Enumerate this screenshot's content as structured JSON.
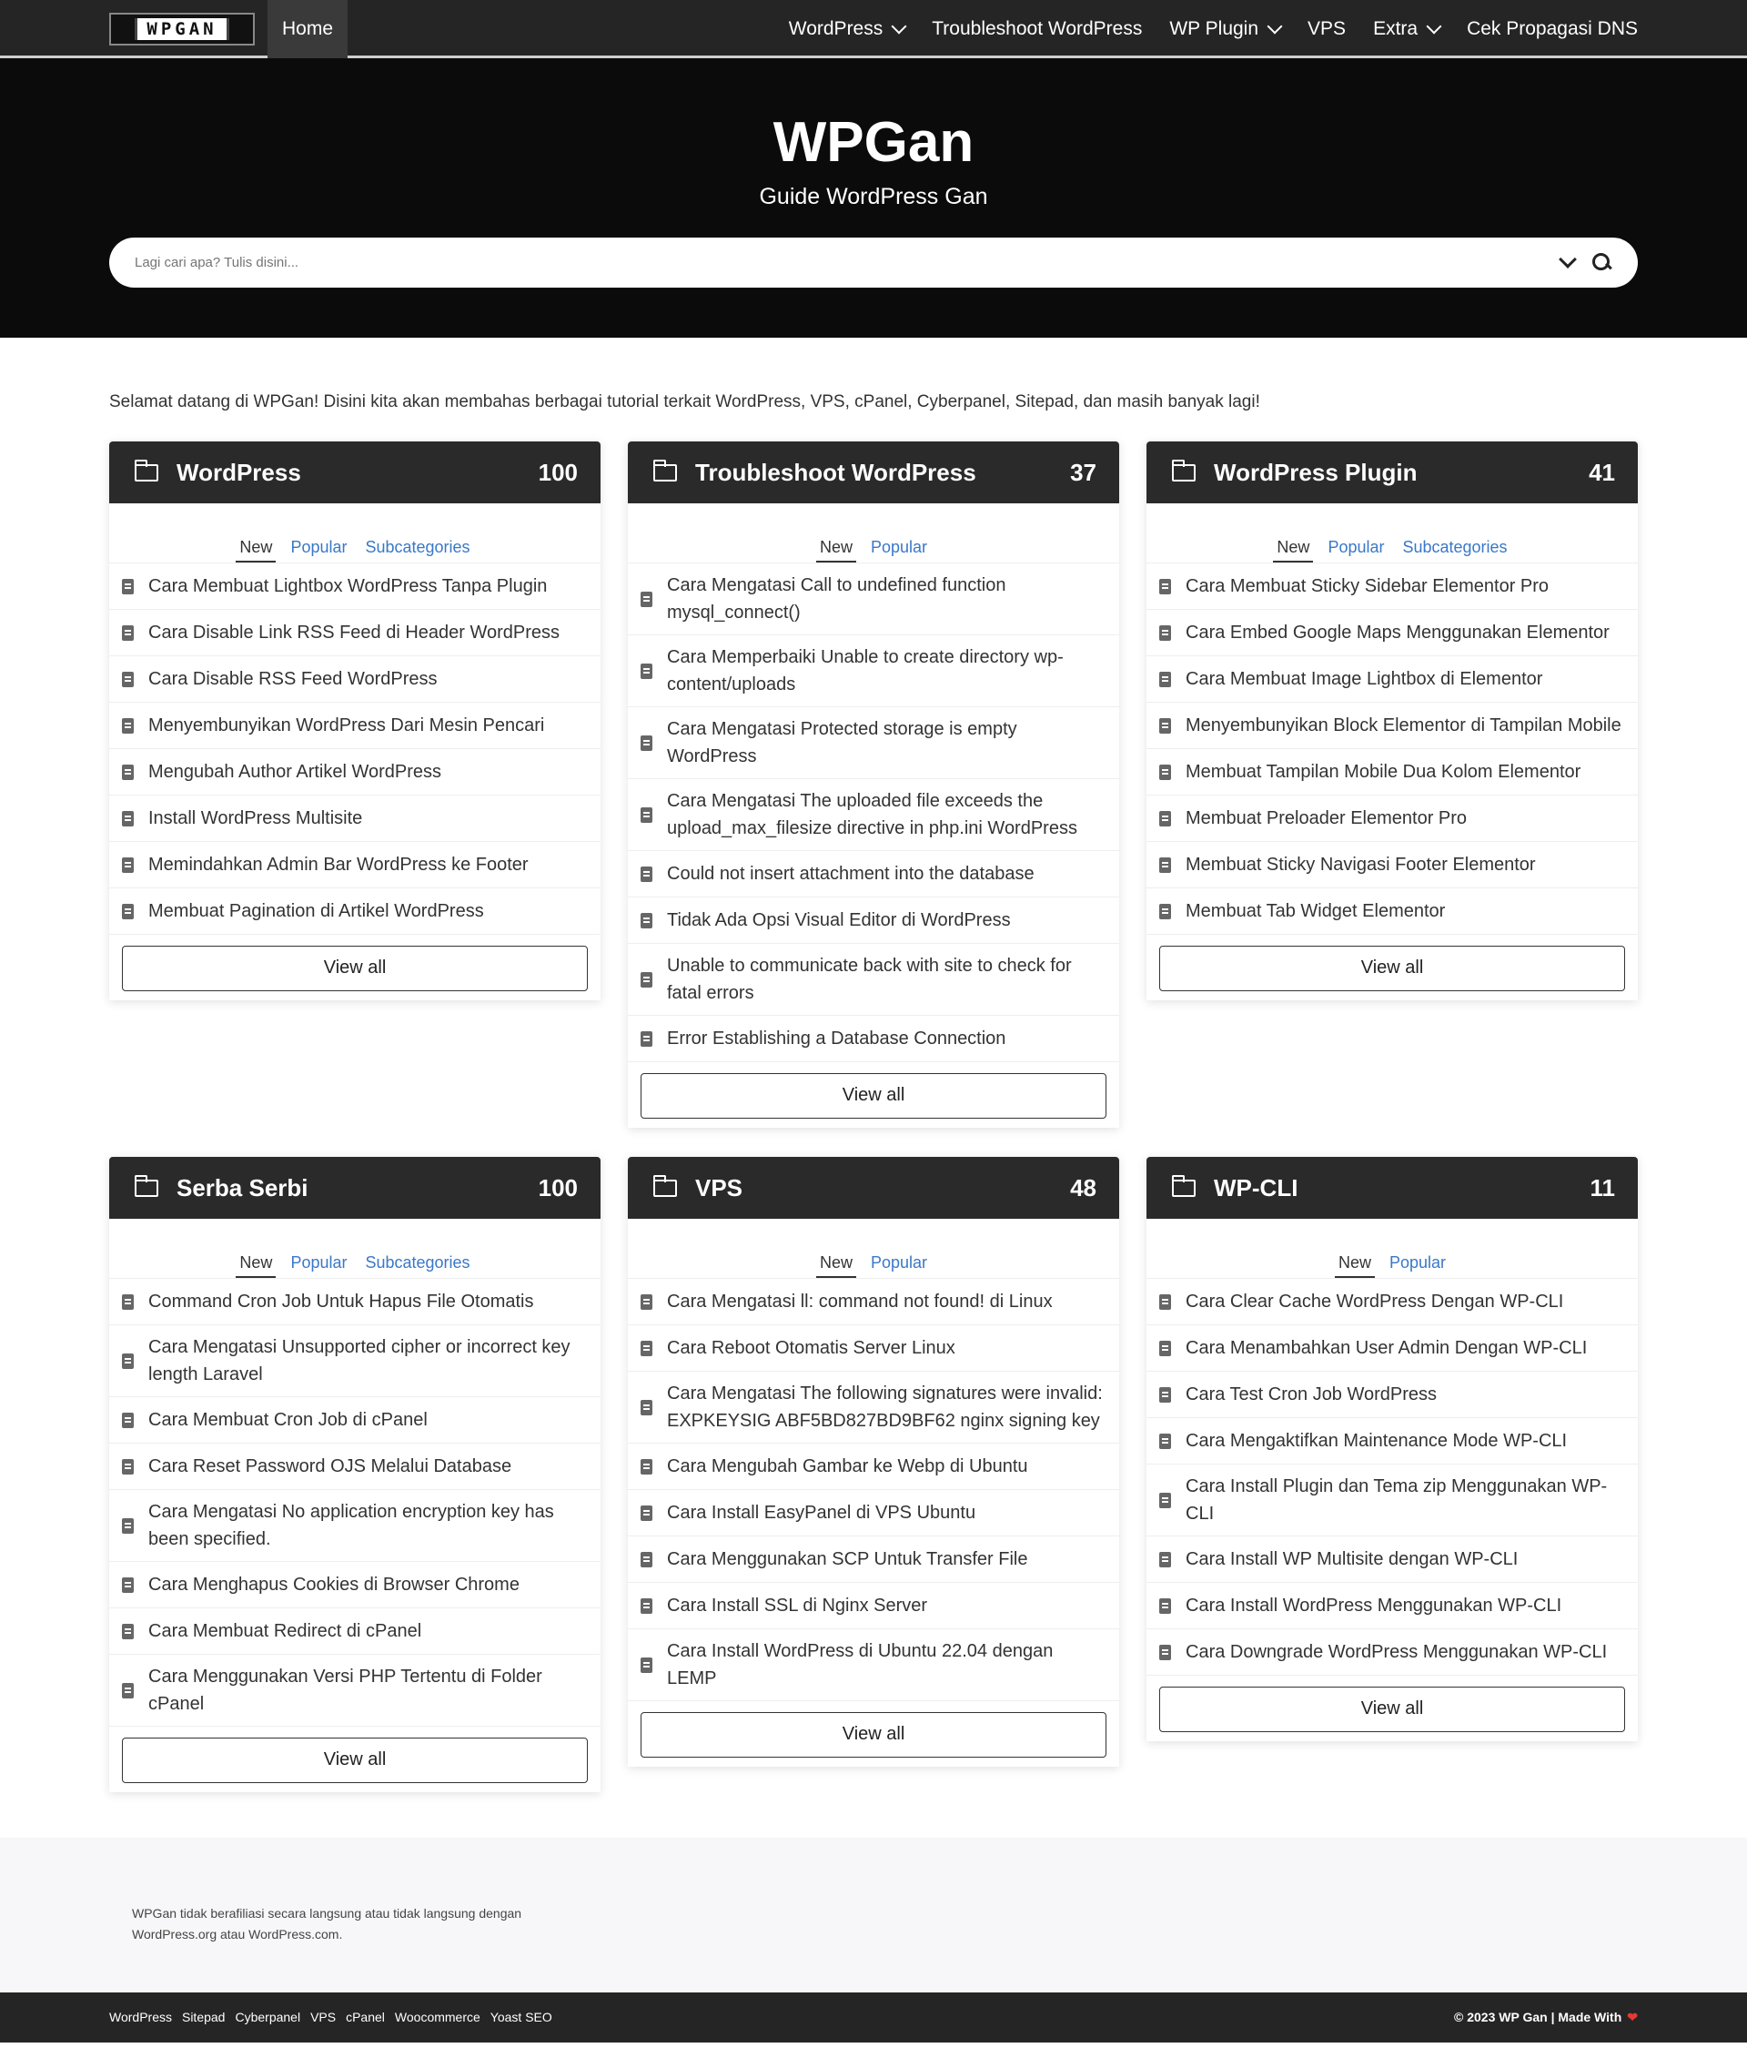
{
  "header": {
    "logo_text": "WPGAN",
    "home": "Home",
    "nav": [
      {
        "label": "WordPress",
        "dropdown": true
      },
      {
        "label": "Troubleshoot WordPress",
        "dropdown": false
      },
      {
        "label": "WP Plugin",
        "dropdown": true
      },
      {
        "label": "VPS",
        "dropdown": false
      },
      {
        "label": "Extra",
        "dropdown": true
      },
      {
        "label": "Cek Propagasi DNS",
        "dropdown": false
      }
    ]
  },
  "hero": {
    "title": "WPGan",
    "subtitle": "Guide WordPress Gan",
    "search_placeholder": "Lagi cari apa? Tulis disini..."
  },
  "intro": "Selamat datang di WPGan! Disini kita akan membahas berbagai tutorial terkait WordPress, VPS, cPanel, Cyberpanel, Sitepad, dan masih banyak lagi!",
  "cards": [
    {
      "title": "WordPress",
      "count": "100",
      "tabs": [
        "New",
        "Popular",
        "Subcategories"
      ],
      "items": [
        "Cara Membuat Lightbox WordPress Tanpa Plugin",
        "Cara Disable Link RSS Feed di Header WordPress",
        "Cara Disable RSS Feed WordPress",
        "Menyembunyikan WordPress Dari Mesin Pencari",
        "Mengubah Author Artikel WordPress",
        "Install WordPress Multisite",
        "Memindahkan Admin Bar WordPress ke Footer",
        "Membuat Pagination di Artikel WordPress"
      ],
      "view_all": "View all"
    },
    {
      "title": "Troubleshoot WordPress",
      "count": "37",
      "tabs": [
        "New",
        "Popular"
      ],
      "items": [
        "Cara Mengatasi Call to undefined function mysql_connect()",
        "Cara Memperbaiki Unable to create directory wp-content/uploads",
        "Cara Mengatasi Protected storage is empty WordPress",
        "Cara Mengatasi The uploaded file exceeds the upload_max_filesize directive in php.ini WordPress",
        "Could not insert attachment into the database",
        "Tidak Ada Opsi Visual Editor di WordPress",
        "Unable to communicate back with site to check for fatal errors",
        "Error Establishing a Database Connection"
      ],
      "view_all": "View all"
    },
    {
      "title": "WordPress Plugin",
      "count": "41",
      "tabs": [
        "New",
        "Popular",
        "Subcategories"
      ],
      "items": [
        "Cara Membuat Sticky Sidebar Elementor Pro",
        "Cara Embed Google Maps Menggunakan Elementor",
        "Cara Membuat Image Lightbox di Elementor",
        "Menyembunyikan Block Elementor di Tampilan Mobile",
        "Membuat Tampilan Mobile Dua Kolom Elementor",
        "Membuat Preloader Elementor Pro",
        "Membuat Sticky Navigasi Footer Elementor",
        "Membuat Tab Widget Elementor"
      ],
      "view_all": "View all"
    },
    {
      "title": "Serba Serbi",
      "count": "100",
      "tabs": [
        "New",
        "Popular",
        "Subcategories"
      ],
      "items": [
        "Command Cron Job Untuk Hapus File Otomatis",
        "Cara Mengatasi Unsupported cipher or incorrect key length Laravel",
        "Cara Membuat Cron Job di cPanel",
        "Cara Reset Password OJS Melalui Database",
        "Cara Mengatasi No application encryption key has been specified.",
        "Cara Menghapus Cookies di Browser Chrome",
        "Cara Membuat Redirect di cPanel",
        "Cara Menggunakan Versi PHP Tertentu di Folder cPanel"
      ],
      "view_all": "View all"
    },
    {
      "title": "VPS",
      "count": "48",
      "tabs": [
        "New",
        "Popular"
      ],
      "items": [
        "Cara Mengatasi ll: command not found! di Linux",
        "Cara Reboot Otomatis Server Linux",
        "Cara Mengatasi The following signatures were invalid: EXPKEYSIG ABF5BD827BD9BF62 nginx signing key",
        "Cara Mengubah Gambar ke Webp di Ubuntu",
        "Cara Install EasyPanel di VPS Ubuntu",
        "Cara Menggunakan SCP Untuk Transfer File",
        "Cara Install SSL di Nginx Server",
        "Cara Install WordPress di Ubuntu 22.04 dengan LEMP"
      ],
      "view_all": "View all"
    },
    {
      "title": "WP-CLI",
      "count": "11",
      "tabs": [
        "New",
        "Popular"
      ],
      "items": [
        "Cara Clear Cache WordPress Dengan WP-CLI",
        "Cara Menambahkan User Admin Dengan WP-CLI",
        "Cara Test Cron Job WordPress",
        "Cara Mengaktifkan Maintenance Mode WP-CLI",
        "Cara Install Plugin dan Tema zip Menggunakan WP-CLI",
        "Cara Install WP Multisite dengan WP-CLI",
        "Cara Install WordPress Menggunakan WP-CLI",
        "Cara Downgrade WordPress Menggunakan WP-CLI"
      ],
      "view_all": "View all"
    }
  ],
  "footer": {
    "disclaimer": "WPGan tidak berafiliasi secara langsung atau tidak langsung dengan WordPress.org atau WordPress.com.",
    "links": [
      "WordPress",
      "Sitepad",
      "Cyberpanel",
      "VPS",
      "cPanel",
      "Woocommerce",
      "Yoast SEO"
    ],
    "copyright": "© 2023 WP Gan | Made With"
  }
}
